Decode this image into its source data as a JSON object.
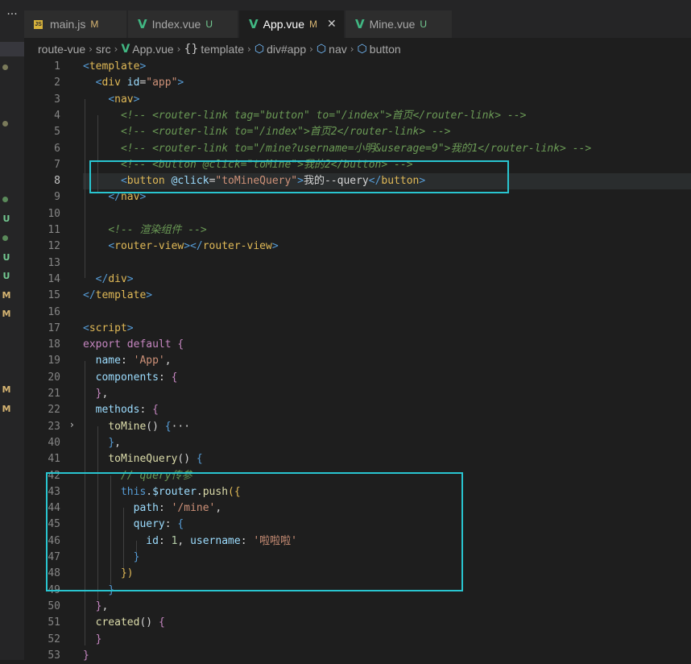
{
  "activity_bar": {
    "more": "···",
    "marks": [
      "U",
      "U",
      "U",
      "M",
      "M",
      "M",
      "M"
    ]
  },
  "tabs": [
    {
      "name": "main.js",
      "status": "M",
      "icon": "js-file-icon"
    },
    {
      "name": "Index.vue",
      "status": "U",
      "icon": "vue-file-icon"
    },
    {
      "name": "App.vue",
      "status": "M",
      "icon": "vue-file-icon",
      "active": true
    },
    {
      "name": "Mine.vue",
      "status": "U",
      "icon": "vue-file-icon"
    }
  ],
  "tab_status_colors": {
    "M": "#d7b572",
    "U": "#73c991"
  },
  "breadcrumb": {
    "items": [
      "route-vue",
      "src",
      "App.vue",
      "template",
      "div#app",
      "nav",
      "button"
    ]
  },
  "editor": {
    "line_numbers": [
      "1",
      "2",
      "3",
      "4",
      "5",
      "6",
      "7",
      "8",
      "9",
      "10",
      "11",
      "12",
      "13",
      "14",
      "15",
      "16",
      "17",
      "18",
      "19",
      "20",
      "21",
      "22",
      "23",
      "40",
      "41",
      "42",
      "43",
      "44",
      "45",
      "46",
      "47",
      "48",
      "49",
      "50",
      "51",
      "52",
      "53"
    ],
    "current_line": "8",
    "lines": [
      [
        [
          "t",
          "<"
        ],
        [
          "tg",
          "template"
        ],
        [
          "t",
          ">"
        ]
      ],
      [
        [
          "w",
          "  "
        ],
        [
          "t",
          "<"
        ],
        [
          "tg",
          "div"
        ],
        [
          "w",
          " "
        ],
        [
          "a",
          "id"
        ],
        [
          "p",
          "="
        ],
        [
          "s",
          "\"app\""
        ],
        [
          "t",
          ">"
        ]
      ],
      [
        [
          "w",
          "    "
        ],
        [
          "t",
          "<"
        ],
        [
          "tg",
          "nav"
        ],
        [
          "t",
          ">"
        ]
      ],
      [
        [
          "w",
          "      "
        ],
        [
          "c",
          "<!-- <router-link tag=\"button\" to=\"/index\">首页</router-link> -->"
        ]
      ],
      [
        [
          "w",
          "      "
        ],
        [
          "c",
          "<!-- <router-link to=\"/index\">首页2</router-link> -->"
        ]
      ],
      [
        [
          "w",
          "      "
        ],
        [
          "c",
          "<!-- <router-link to=\"/mine?username=小明&userage=9\">我的1</router-link> -->"
        ]
      ],
      [
        [
          "w",
          "      "
        ],
        [
          "c",
          "<!-- <button @click=\"toMine\">我的2</button> -->"
        ]
      ],
      [
        [
          "w",
          "      "
        ],
        [
          "t",
          "<"
        ],
        [
          "tg",
          "button"
        ],
        [
          "w",
          " "
        ],
        [
          "a",
          "@click"
        ],
        [
          "p",
          "="
        ],
        [
          "s",
          "\"toMineQuery\""
        ],
        [
          "t",
          ">"
        ],
        [
          "w",
          "我的--query"
        ],
        [
          "t",
          "</"
        ],
        [
          "tg",
          "button"
        ],
        [
          "t",
          ">"
        ]
      ],
      [
        [
          "w",
          "    "
        ],
        [
          "t",
          "</"
        ],
        [
          "tg",
          "nav"
        ],
        [
          "t",
          ">"
        ]
      ],
      [],
      [
        [
          "w",
          "    "
        ],
        [
          "c",
          "<!-- 渲染组件 -->"
        ]
      ],
      [
        [
          "w",
          "    "
        ],
        [
          "t",
          "<"
        ],
        [
          "tg",
          "router-view"
        ],
        [
          "t",
          "></"
        ],
        [
          "tg",
          "router-view"
        ],
        [
          "t",
          ">"
        ]
      ],
      [],
      [
        [
          "w",
          "  "
        ],
        [
          "t",
          "</"
        ],
        [
          "tg",
          "div"
        ],
        [
          "t",
          ">"
        ]
      ],
      [
        [
          "t",
          "</"
        ],
        [
          "tg",
          "template"
        ],
        [
          "t",
          ">"
        ]
      ],
      [],
      [
        [
          "t",
          "<"
        ],
        [
          "tg",
          "script"
        ],
        [
          "t",
          ">"
        ]
      ],
      [
        [
          "k",
          "export default"
        ],
        [
          "w",
          " "
        ],
        [
          "k",
          "{"
        ]
      ],
      [
        [
          "w",
          "  "
        ],
        [
          "a",
          "name"
        ],
        [
          "p",
          ": "
        ],
        [
          "s",
          "'App'"
        ],
        [
          "p",
          ","
        ]
      ],
      [
        [
          "w",
          "  "
        ],
        [
          "a",
          "components"
        ],
        [
          "p",
          ": "
        ],
        [
          "k",
          "{"
        ]
      ],
      [
        [
          "w",
          "  "
        ],
        [
          "k",
          "}"
        ],
        [
          "p",
          ","
        ]
      ],
      [
        [
          "w",
          "  "
        ],
        [
          "a",
          "methods"
        ],
        [
          "p",
          ": "
        ],
        [
          "k",
          "{"
        ]
      ],
      [
        [
          "w",
          "    "
        ],
        [
          "f",
          "toMine"
        ],
        [
          "p",
          "() "
        ],
        [
          "t",
          "{"
        ],
        [
          "p",
          "···"
        ]
      ],
      [
        [
          "w",
          "    "
        ],
        [
          "t",
          "}"
        ],
        [
          "p",
          ","
        ]
      ],
      [
        [
          "w",
          "    "
        ],
        [
          "f",
          "toMineQuery"
        ],
        [
          "p",
          "() "
        ],
        [
          "t",
          "{"
        ]
      ],
      [
        [
          "w",
          "      "
        ],
        [
          "c",
          "// query传参"
        ]
      ],
      [
        [
          "w",
          "      "
        ],
        [
          "t",
          "this"
        ],
        [
          "p",
          "."
        ],
        [
          "a",
          "$router"
        ],
        [
          "p",
          "."
        ],
        [
          "f",
          "push"
        ],
        [
          "tg",
          "({"
        ]
      ],
      [
        [
          "w",
          "        "
        ],
        [
          "a",
          "path"
        ],
        [
          "p",
          ": "
        ],
        [
          "s",
          "'/mine'"
        ],
        [
          "p",
          ","
        ]
      ],
      [
        [
          "w",
          "        "
        ],
        [
          "a",
          "query"
        ],
        [
          "p",
          ": "
        ],
        [
          "t",
          "{"
        ]
      ],
      [
        [
          "w",
          "          "
        ],
        [
          "a",
          "id"
        ],
        [
          "p",
          ": "
        ],
        [
          "n",
          "1"
        ],
        [
          "p",
          ", "
        ],
        [
          "a",
          "username"
        ],
        [
          "p",
          ": "
        ],
        [
          "s",
          "'啦啦啦'"
        ]
      ],
      [
        [
          "w",
          "        "
        ],
        [
          "t",
          "}"
        ]
      ],
      [
        [
          "w",
          "      "
        ],
        [
          "tg",
          "})"
        ]
      ],
      [
        [
          "w",
          "    "
        ],
        [
          "t",
          "}"
        ]
      ],
      [
        [
          "w",
          "  "
        ],
        [
          "k",
          "}"
        ],
        [
          "p",
          ","
        ]
      ],
      [
        [
          "w",
          "  "
        ],
        [
          "f",
          "created"
        ],
        [
          "p",
          "() "
        ],
        [
          "k",
          "{"
        ]
      ],
      [
        [
          "w",
          "  "
        ],
        [
          "k",
          "}"
        ]
      ],
      [
        [
          "k",
          "}"
        ]
      ]
    ]
  },
  "colors": {
    "highlight_box": "#29c5d0",
    "vue_icon": "#41b883",
    "js_icon": "#d7b23b"
  }
}
